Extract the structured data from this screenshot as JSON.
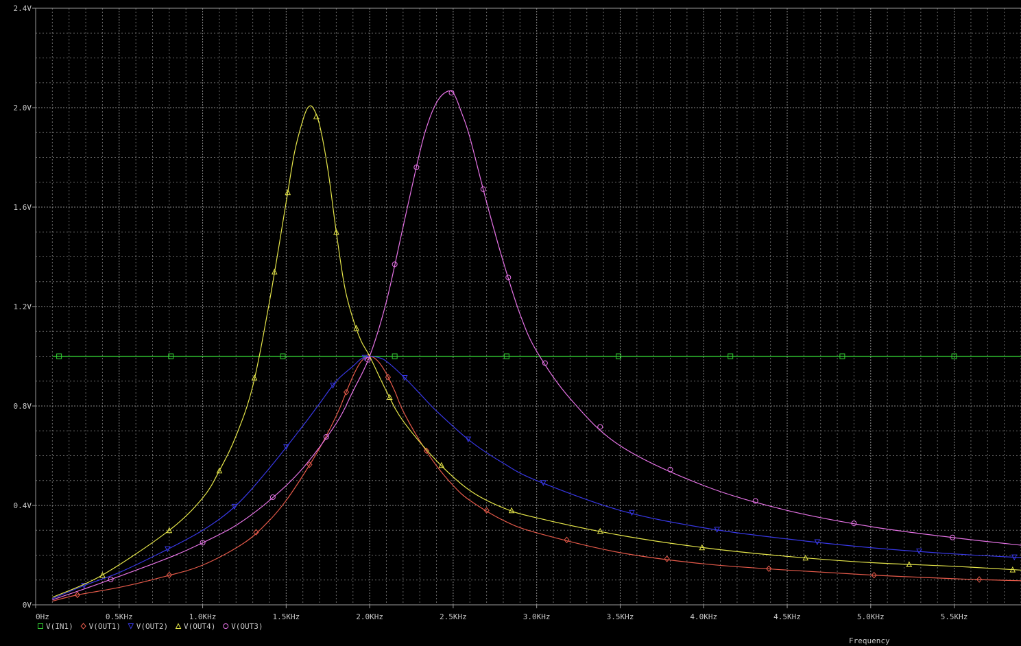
{
  "chart_data": {
    "type": "line",
    "xlabel": "Frequency",
    "ylabel": "",
    "xlim": [
      0,
      5900
    ],
    "ylim": [
      0,
      2.4
    ],
    "grid": true,
    "legend_placement": "bottom-left",
    "x_ticks": [
      {
        "value": 0,
        "label": "0Hz"
      },
      {
        "value": 500,
        "label": "0.5KHz"
      },
      {
        "value": 1000,
        "label": "1.0KHz"
      },
      {
        "value": 1500,
        "label": "1.5KHz"
      },
      {
        "value": 2000,
        "label": "2.0KHz"
      },
      {
        "value": 2500,
        "label": "2.5KHz"
      },
      {
        "value": 3000,
        "label": "3.0KHz"
      },
      {
        "value": 3500,
        "label": "3.5KHz"
      },
      {
        "value": 4000,
        "label": "4.0KHz"
      },
      {
        "value": 4500,
        "label": "4.5KHz"
      },
      {
        "value": 5000,
        "label": "5.0KHz"
      },
      {
        "value": 5500,
        "label": "5.5KHz"
      }
    ],
    "y_ticks": [
      {
        "value": 0,
        "label": "0V"
      },
      {
        "value": 0.4,
        "label": "0.4V"
      },
      {
        "value": 0.8,
        "label": "0.8V"
      },
      {
        "value": 1.2,
        "label": "1.2V"
      },
      {
        "value": 1.6,
        "label": "1.6V"
      },
      {
        "value": 2.0,
        "label": "2.0V"
      },
      {
        "value": 2.4,
        "label": "2.4V"
      }
    ],
    "series": [
      {
        "name": "V(IN1)",
        "color": "#33cc33",
        "marker": "square",
        "x": [
          100,
          5900
        ],
        "y": [
          1.0,
          1.0
        ],
        "marker_x": [
          140,
          810,
          1480,
          2150,
          2820,
          3490,
          4160,
          4830,
          5500
        ]
      },
      {
        "name": "V(OUT1)",
        "color": "#e65a4a",
        "marker": "diamond",
        "x": [
          100,
          250,
          500,
          750,
          1000,
          1250,
          1400,
          1500,
          1600,
          1700,
          1800,
          1850,
          1900,
          1950,
          2000,
          2050,
          2100,
          2150,
          2200,
          2300,
          2400,
          2500,
          2600,
          2800,
          3000,
          3500,
          4000,
          4500,
          5000,
          5500,
          5900
        ],
        "y": [
          0.015,
          0.04,
          0.07,
          0.11,
          0.16,
          0.25,
          0.34,
          0.42,
          0.52,
          0.63,
          0.76,
          0.84,
          0.92,
          0.98,
          1.0,
          0.98,
          0.93,
          0.86,
          0.78,
          0.66,
          0.56,
          0.48,
          0.42,
          0.34,
          0.29,
          0.21,
          0.165,
          0.14,
          0.12,
          0.105,
          0.097
        ],
        "marker_x": [
          250,
          800,
          1320,
          1640,
          1860,
          1990,
          2110,
          2340,
          2700,
          3180,
          3780,
          4390,
          5020,
          5650
        ]
      },
      {
        "name": "V(OUT2)",
        "color": "#3838e6",
        "marker": "triangle-down",
        "x": [
          100,
          300,
          500,
          750,
          1000,
          1200,
          1400,
          1600,
          1700,
          1800,
          1900,
          1950,
          2000,
          2050,
          2100,
          2200,
          2300,
          2400,
          2600,
          2800,
          3000,
          3500,
          4000,
          4500,
          5000,
          5500,
          5900
        ],
        "y": [
          0.025,
          0.08,
          0.13,
          0.21,
          0.3,
          0.4,
          0.55,
          0.72,
          0.81,
          0.9,
          0.96,
          0.99,
          1.0,
          0.995,
          0.98,
          0.92,
          0.85,
          0.78,
          0.66,
          0.57,
          0.5,
          0.38,
          0.31,
          0.265,
          0.23,
          0.205,
          0.19
        ],
        "marker_x": [
          290,
          790,
          1190,
          1500,
          1780,
          1970,
          2210,
          2590,
          3040,
          3570,
          4080,
          4680,
          5290,
          5860
        ]
      },
      {
        "name": "V(OUT4)",
        "color": "#e6e64a",
        "marker": "triangle-up",
        "x": [
          100,
          400,
          800,
          1000,
          1100,
          1200,
          1300,
          1400,
          1500,
          1550,
          1600,
          1630,
          1660,
          1700,
          1750,
          1800,
          1850,
          1900,
          1950,
          2000,
          2100,
          2200,
          2400,
          2600,
          2800,
          3000,
          3500,
          4000,
          4500,
          5000,
          5500,
          5900
        ],
        "y": [
          0.03,
          0.12,
          0.3,
          0.43,
          0.54,
          0.68,
          0.88,
          1.22,
          1.62,
          1.82,
          1.95,
          2.0,
          2.0,
          1.93,
          1.75,
          1.5,
          1.28,
          1.15,
          1.06,
          1.0,
          0.86,
          0.74,
          0.58,
          0.46,
          0.39,
          0.35,
          0.28,
          0.23,
          0.195,
          0.17,
          0.155,
          0.14
        ],
        "marker_x": [
          400,
          800,
          1100,
          1310,
          1430,
          1510,
          1680,
          1800,
          1920,
          2120,
          2430,
          2850,
          3380,
          3990,
          4610,
          5230,
          5850
        ]
      },
      {
        "name": "V(OUT3)",
        "color": "#e673e6",
        "marker": "circle",
        "x": [
          100,
          400,
          800,
          1000,
          1200,
          1400,
          1600,
          1800,
          1900,
          2000,
          2100,
          2200,
          2300,
          2350,
          2400,
          2450,
          2500,
          2550,
          2600,
          2700,
          2800,
          2900,
          3000,
          3200,
          3500,
          4000,
          4500,
          5000,
          5500,
          5900
        ],
        "y": [
          0.02,
          0.09,
          0.19,
          0.25,
          0.32,
          0.42,
          0.55,
          0.73,
          0.86,
          1.0,
          1.22,
          1.52,
          1.82,
          1.94,
          2.02,
          2.06,
          2.06,
          1.98,
          1.88,
          1.62,
          1.38,
          1.17,
          1.02,
          0.83,
          0.64,
          0.48,
          0.38,
          0.315,
          0.27,
          0.24
        ],
        "marker_x": [
          450,
          1000,
          1420,
          1740,
          1990,
          2150,
          2280,
          2490,
          2680,
          2830,
          3050,
          3380,
          3800,
          4310,
          4900,
          5490
        ]
      }
    ]
  }
}
